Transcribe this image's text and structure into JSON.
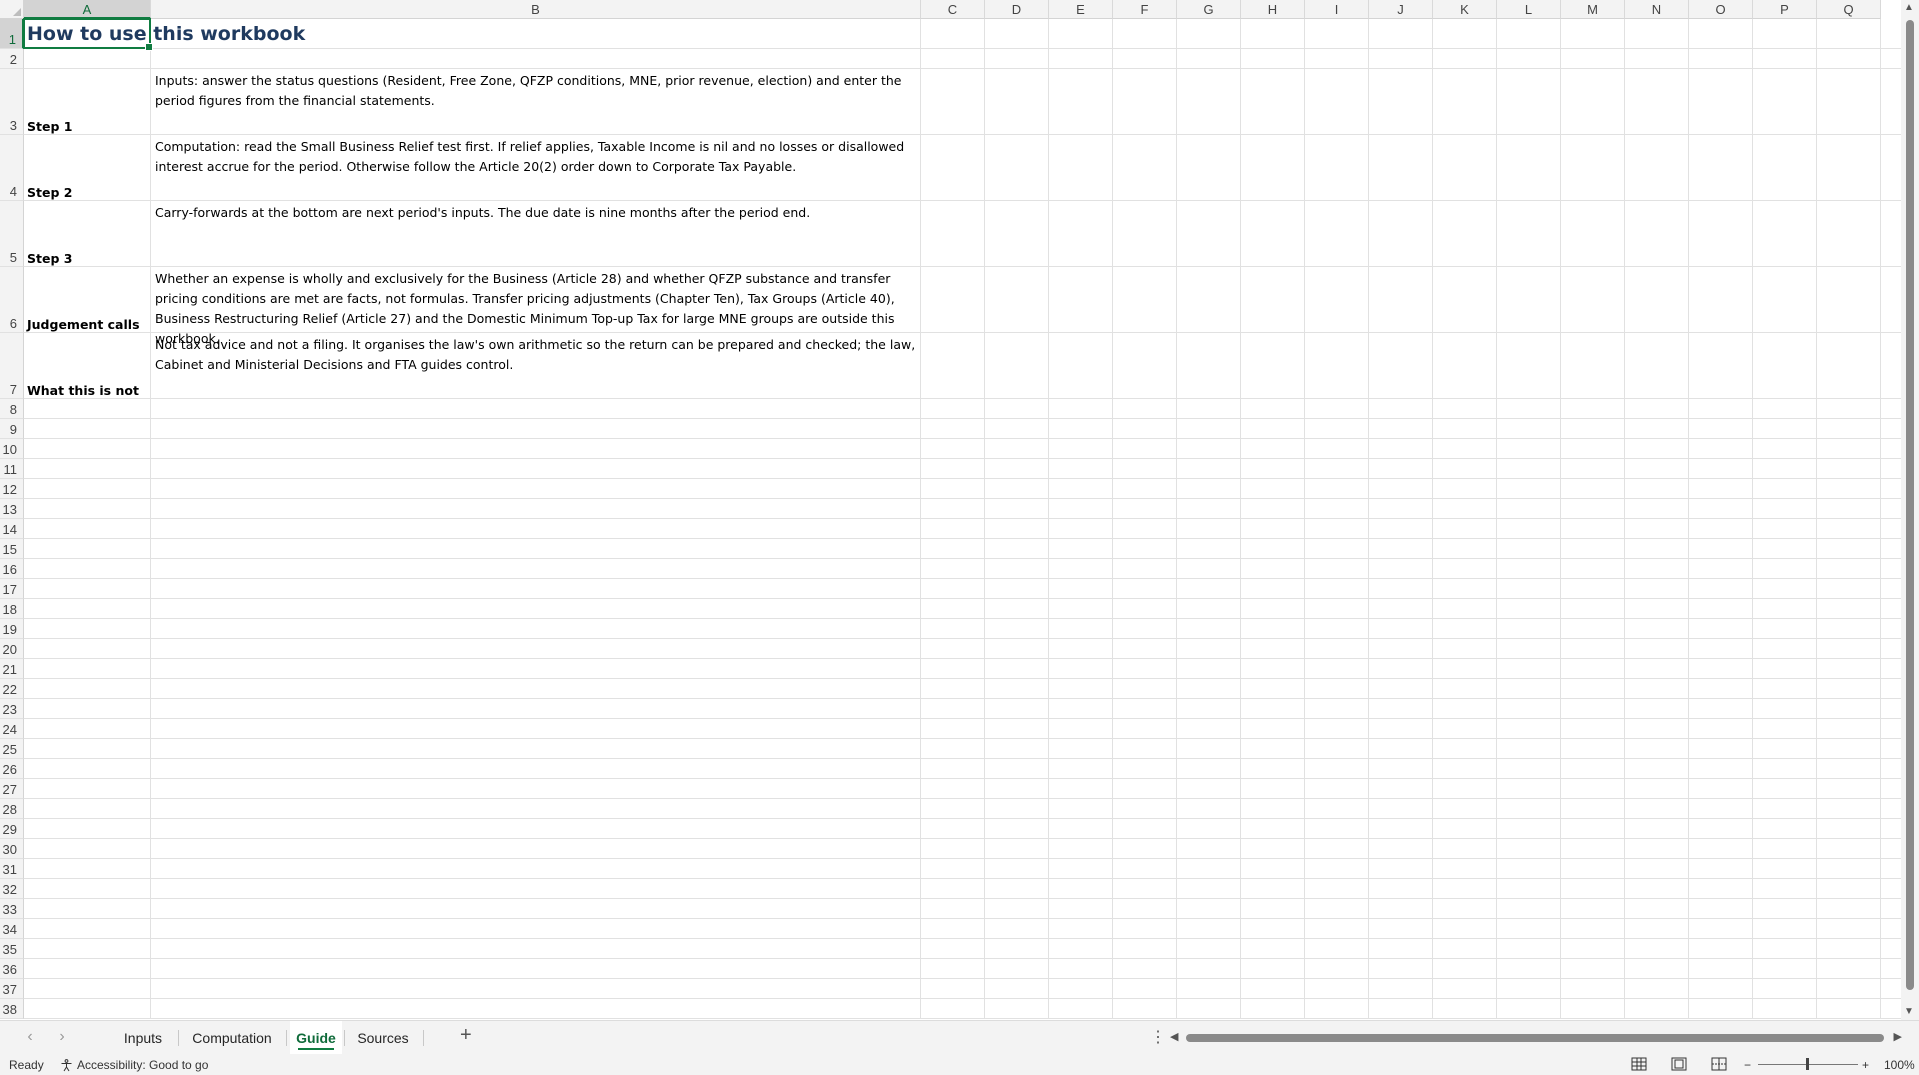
{
  "columns": [
    "A",
    "B",
    "C",
    "D",
    "E",
    "F",
    "G",
    "H",
    "I",
    "J",
    "K",
    "L",
    "M",
    "N",
    "O",
    "P",
    "Q"
  ],
  "selected_column": "A",
  "selected_row": "1",
  "rows": [
    "1",
    "2",
    "3",
    "4",
    "5",
    "6",
    "7",
    "8",
    "9",
    "10",
    "11",
    "12",
    "13",
    "14",
    "15",
    "16",
    "17",
    "18",
    "19",
    "20",
    "21",
    "22",
    "23",
    "24",
    "25",
    "26",
    "27",
    "28",
    "29",
    "30",
    "31",
    "32",
    "33",
    "34",
    "35",
    "36",
    "37",
    "38"
  ],
  "cells": {
    "A1": "How to use this workbook",
    "A3": "Step 1",
    "B3": "Inputs: answer the status questions (Resident, Free Zone, QFZP conditions, MNE, prior revenue, election) and enter the period figures from the financial statements.",
    "A4": "Step 2",
    "B4": "Computation: read the Small Business Relief test first. If relief applies, Taxable Income is nil and no losses or disallowed interest accrue for the period. Otherwise follow the Article 20(2) order down to Corporate Tax Payable.",
    "A5": "Step 3",
    "B5": "Carry-forwards at the bottom are next period's inputs. The due date is nine months after the period end.",
    "A6": "Judgement calls",
    "B6": "Whether an expense is wholly and exclusively for the Business (Article 28) and whether QFZP substance and transfer pricing conditions are met are facts, not formulas. Transfer pricing adjustments (Chapter Ten), Tax Groups (Article 40), Business Restructuring Relief (Article 27) and the Domestic Minimum Top-up Tax for large MNE groups are outside this workbook.",
    "A7": "What this is not",
    "B7": "Not tax advice and not a filing. It organises the law's own arithmetic so the return can be prepared and checked; the law, Cabinet and Ministerial Decisions and FTA guides control."
  },
  "sheet_tabs": [
    {
      "label": "Inputs",
      "active": false
    },
    {
      "label": "Computation",
      "active": false
    },
    {
      "label": "Guide",
      "active": true
    },
    {
      "label": "Sources",
      "active": false
    }
  ],
  "status": {
    "ready": "Ready",
    "accessibility": "Accessibility: Good to go",
    "zoom": "100%"
  },
  "colors": {
    "accent": "#107c41",
    "title": "#1f3a5f"
  }
}
